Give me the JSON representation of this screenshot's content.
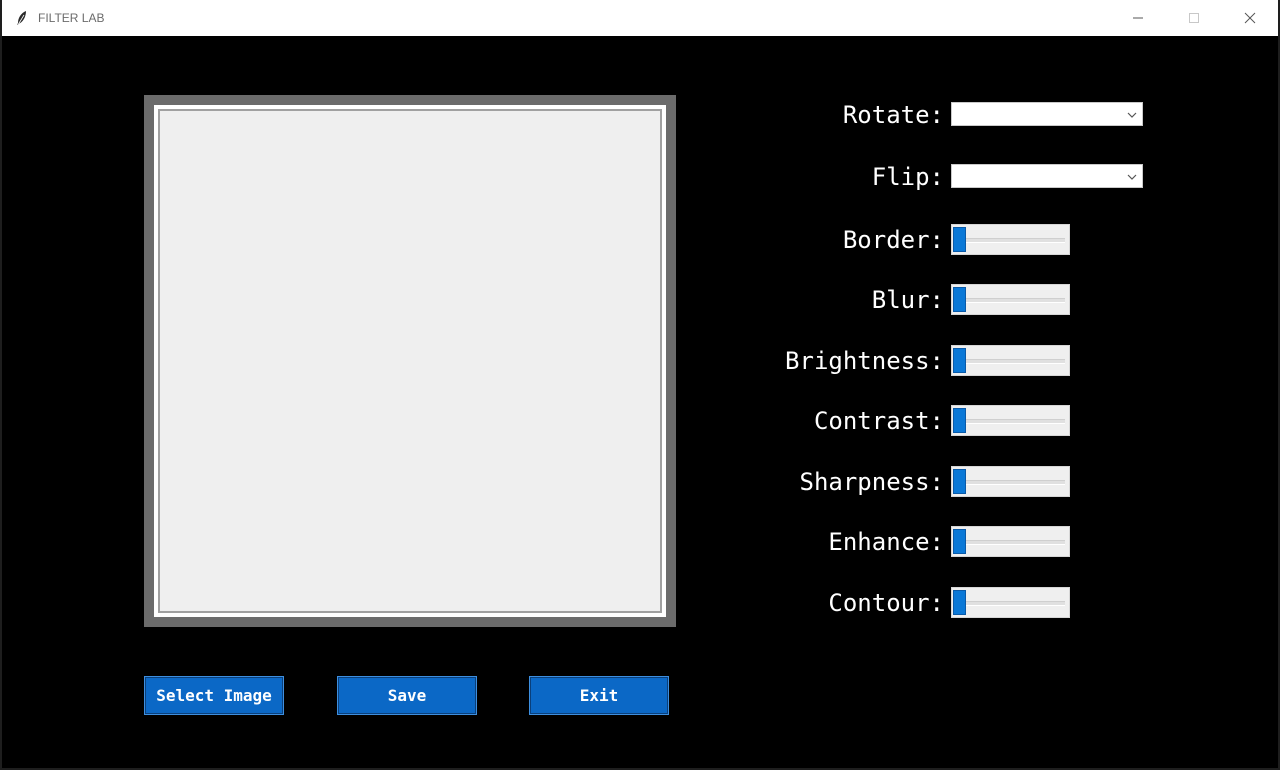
{
  "window": {
    "title": "FILTER LAB",
    "icons": {
      "app": "feather-icon",
      "minimize": "minimize-icon",
      "maximize": "maximize-icon",
      "close": "close-icon"
    }
  },
  "colors": {
    "background": "#000000",
    "button_bg": "#0b68c6",
    "slider_thumb": "#0a78d7",
    "canvas_frame": "#6b6b6b",
    "canvas_fill": "#efefef"
  },
  "controls": {
    "rotate": {
      "label": "Rotate:",
      "value": ""
    },
    "flip": {
      "label": "Flip:",
      "value": ""
    },
    "sliders": [
      {
        "label": "Border:",
        "value": 0
      },
      {
        "label": "Blur:",
        "value": 0
      },
      {
        "label": "Brightness:",
        "value": 0
      },
      {
        "label": "Contrast:",
        "value": 0
      },
      {
        "label": "Sharpness:",
        "value": 0
      },
      {
        "label": "Enhance:",
        "value": 0
      },
      {
        "label": "Contour:",
        "value": 0
      }
    ]
  },
  "buttons": {
    "select_image": "Select Image",
    "save": "Save",
    "exit": "Exit"
  }
}
